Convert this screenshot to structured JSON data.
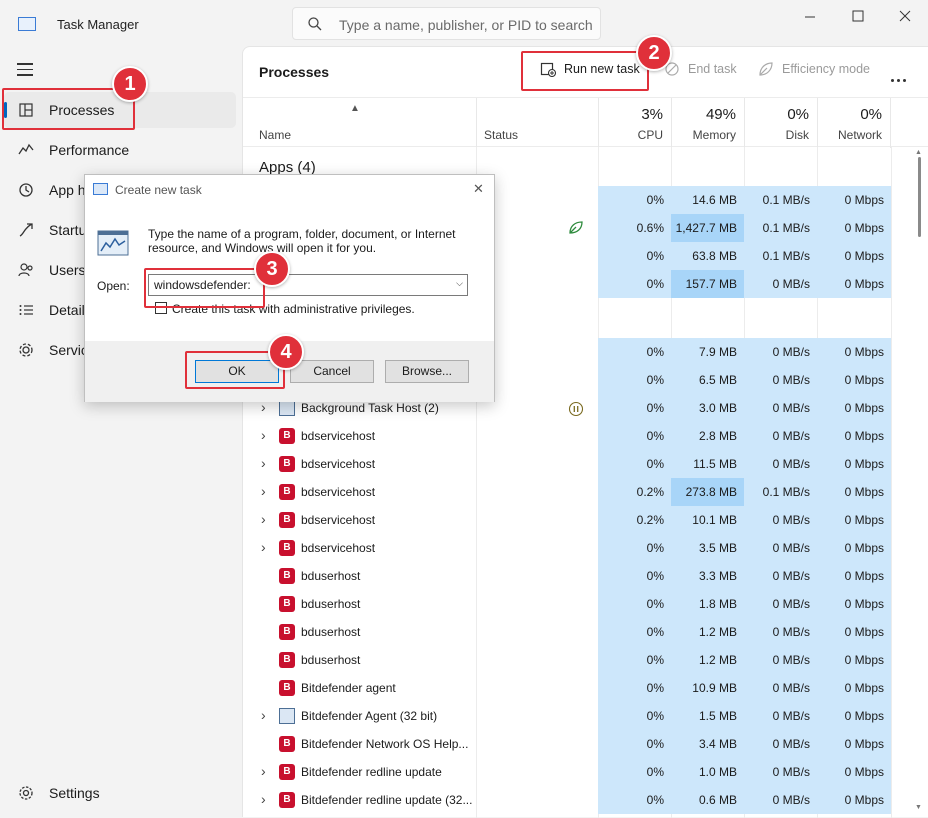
{
  "app": {
    "title": "Task Manager"
  },
  "search": {
    "placeholder": "Type a name, publisher, or PID to search"
  },
  "sidebar": {
    "items": [
      {
        "label": "Processes",
        "icon": "processes-icon"
      },
      {
        "label": "Performance",
        "icon": "performance-icon"
      },
      {
        "label": "App history",
        "icon": "app-history-icon"
      },
      {
        "label": "Startup apps",
        "icon": "startup-icon"
      },
      {
        "label": "Users",
        "icon": "users-icon"
      },
      {
        "label": "Details",
        "icon": "details-icon"
      },
      {
        "label": "Services",
        "icon": "services-icon"
      }
    ],
    "settings_label": "Settings"
  },
  "toolbar": {
    "title": "Processes",
    "run_new_task": "Run new task",
    "end_task": "End task",
    "efficiency_mode": "Efficiency mode"
  },
  "columns": {
    "name": "Name",
    "status": "Status",
    "cpu": {
      "pct": "3%",
      "label": "CPU"
    },
    "memory": {
      "pct": "49%",
      "label": "Memory"
    },
    "disk": {
      "pct": "0%",
      "label": "Disk"
    },
    "network": {
      "pct": "0%",
      "label": "Network"
    }
  },
  "groups": {
    "apps": "Apps (4)"
  },
  "app_rows": [
    {
      "cpu": "0%",
      "mem": "14.6 MB",
      "disk": "0.1 MB/s",
      "net": "0 Mbps"
    },
    {
      "cpu": "0.6%",
      "mem": "1,427.7 MB",
      "disk": "0.1 MB/s",
      "net": "0 Mbps"
    },
    {
      "cpu": "0%",
      "mem": "63.8 MB",
      "disk": "0.1 MB/s",
      "net": "0 Mbps"
    },
    {
      "cpu": "0%",
      "mem": "157.7 MB",
      "disk": "0 MB/s",
      "net": "0 Mbps"
    }
  ],
  "bg_rows": [
    {
      "name": "",
      "cpu": "0%",
      "mem": "7.9 MB",
      "disk": "0 MB/s",
      "net": "0 Mbps"
    },
    {
      "name": "",
      "cpu": "0%",
      "mem": "6.5 MB",
      "disk": "0 MB/s",
      "net": "0 Mbps"
    },
    {
      "name": "Background Task Host (2)",
      "cpu": "0%",
      "mem": "3.0 MB",
      "disk": "0 MB/s",
      "net": "0 Mbps"
    },
    {
      "name": "bdservicehost",
      "cpu": "0%",
      "mem": "2.8 MB",
      "disk": "0 MB/s",
      "net": "0 Mbps"
    },
    {
      "name": "bdservicehost",
      "cpu": "0%",
      "mem": "11.5 MB",
      "disk": "0 MB/s",
      "net": "0 Mbps"
    },
    {
      "name": "bdservicehost",
      "cpu": "0.2%",
      "mem": "273.8 MB",
      "disk": "0.1 MB/s",
      "net": "0 Mbps"
    },
    {
      "name": "bdservicehost",
      "cpu": "0.2%",
      "mem": "10.1 MB",
      "disk": "0 MB/s",
      "net": "0 Mbps"
    },
    {
      "name": "bdservicehost",
      "cpu": "0%",
      "mem": "3.5 MB",
      "disk": "0 MB/s",
      "net": "0 Mbps"
    },
    {
      "name": "bduserhost",
      "cpu": "0%",
      "mem": "3.3 MB",
      "disk": "0 MB/s",
      "net": "0 Mbps"
    },
    {
      "name": "bduserhost",
      "cpu": "0%",
      "mem": "1.8 MB",
      "disk": "0 MB/s",
      "net": "0 Mbps"
    },
    {
      "name": "bduserhost",
      "cpu": "0%",
      "mem": "1.2 MB",
      "disk": "0 MB/s",
      "net": "0 Mbps"
    },
    {
      "name": "bduserhost",
      "cpu": "0%",
      "mem": "1.2 MB",
      "disk": "0 MB/s",
      "net": "0 Mbps"
    },
    {
      "name": "Bitdefender agent",
      "cpu": "0%",
      "mem": "10.9 MB",
      "disk": "0 MB/s",
      "net": "0 Mbps"
    },
    {
      "name": "Bitdefender Agent (32 bit)",
      "cpu": "0%",
      "mem": "1.5 MB",
      "disk": "0 MB/s",
      "net": "0 Mbps"
    },
    {
      "name": "Bitdefender Network OS Help...",
      "cpu": "0%",
      "mem": "3.4 MB",
      "disk": "0 MB/s",
      "net": "0 Mbps"
    },
    {
      "name": "Bitdefender redline update",
      "cpu": "0%",
      "mem": "1.0 MB",
      "disk": "0 MB/s",
      "net": "0 Mbps"
    },
    {
      "name": "Bitdefender redline update (32...",
      "cpu": "0%",
      "mem": "0.6 MB",
      "disk": "0 MB/s",
      "net": "0 Mbps"
    }
  ],
  "dialog": {
    "title": "Create new task",
    "description": "Type the name of a program, folder, document, or Internet resource, and Windows will open it for you.",
    "open_label": "Open:",
    "open_value": "windowsdefender:",
    "admin_label": "Create this task with administrative privileges.",
    "ok": "OK",
    "cancel": "Cancel",
    "browse": "Browse..."
  },
  "annotations": {
    "step1": "1",
    "step2": "2",
    "step3": "3",
    "step4": "4"
  },
  "colors": {
    "accent": "#0067c0",
    "callout": "#e0303a",
    "heat_light": "#cde7fb",
    "heat_dark": "#a8d5f8",
    "bitdefender": "#c8102e"
  }
}
